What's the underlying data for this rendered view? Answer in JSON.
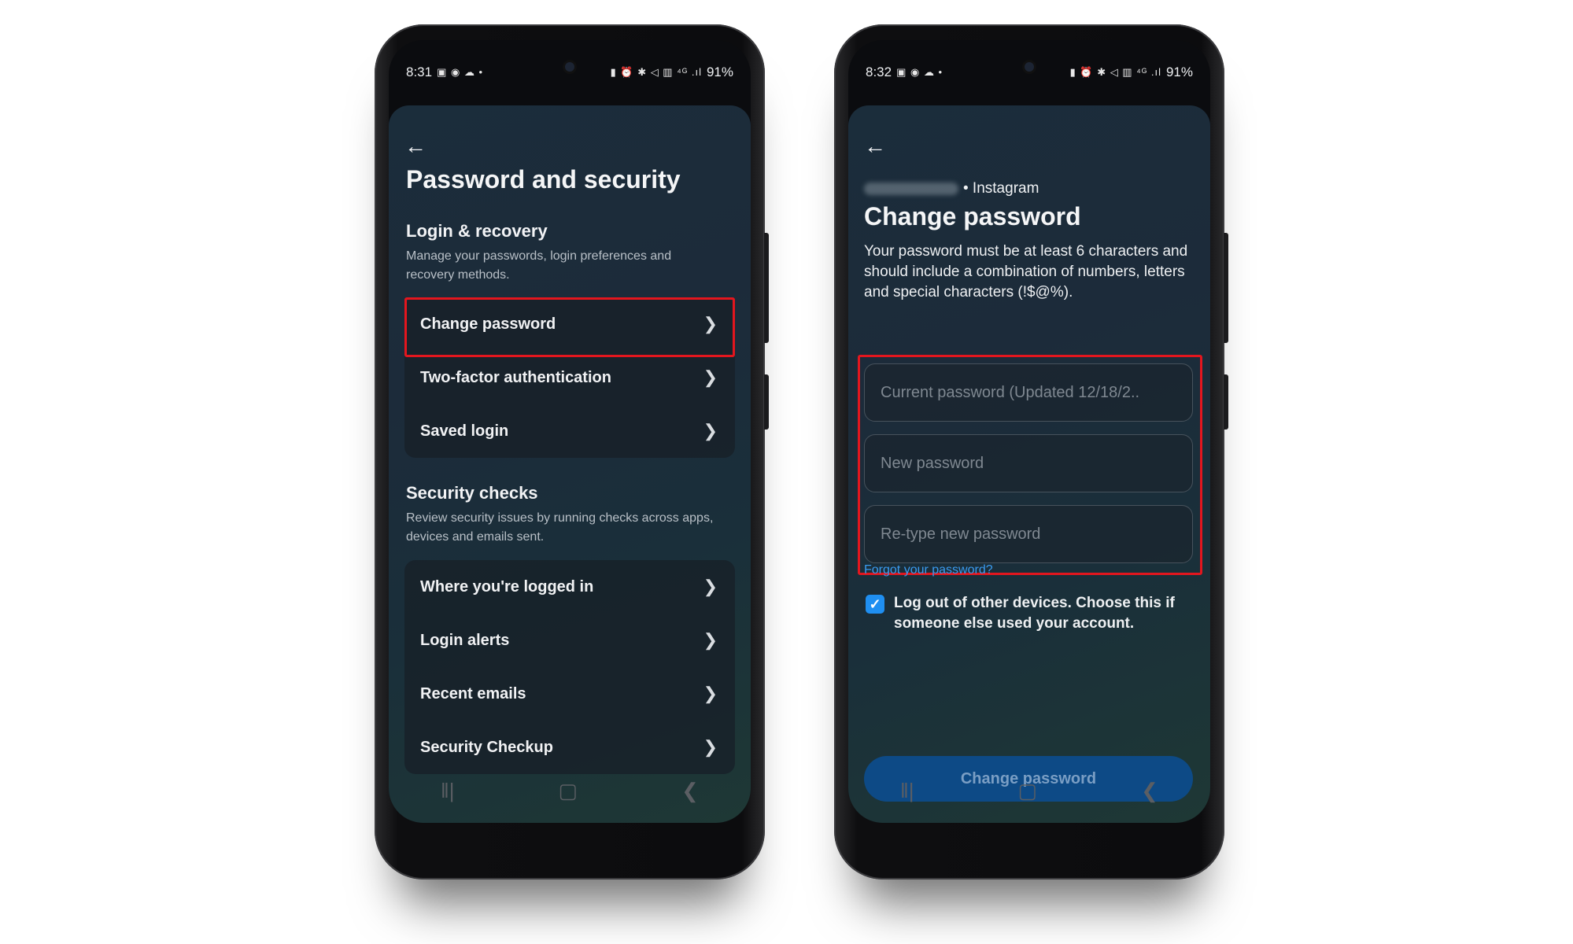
{
  "left_phone": {
    "status": {
      "time": "8:31",
      "icons": "▣ ◉ ☁ •",
      "right_icons": "▮ ⏰ ✱ ◁ ▥ ⁴ᴳ .ıl",
      "battery": "91%"
    },
    "page_title": "Password and security",
    "login_recovery": {
      "title": "Login & recovery",
      "description": "Manage your passwords, login preferences and recovery methods.",
      "items": [
        {
          "label": "Change password"
        },
        {
          "label": "Two-factor authentication"
        },
        {
          "label": "Saved login"
        }
      ]
    },
    "security_checks": {
      "title": "Security checks",
      "description": "Review security issues by running checks across apps, devices and emails sent.",
      "items": [
        {
          "label": "Where you're logged in"
        },
        {
          "label": "Login alerts"
        },
        {
          "label": "Recent emails"
        },
        {
          "label": "Security Checkup"
        }
      ]
    }
  },
  "right_phone": {
    "status": {
      "time": "8:32",
      "icons": "▣ ◉ ☁ •",
      "right_icons": "▮ ⏰ ✱ ◁ ▥ ⁴ᴳ .ıl",
      "battery": "91%"
    },
    "account_suffix": "• Instagram",
    "title": "Change password",
    "description": "Your password must be at least 6 characters and should include a combination of numbers, letters and special characters (!$@%).",
    "fields": {
      "current": "Current password (Updated 12/18/2..",
      "new": "New password",
      "retype": "Re-type new password"
    },
    "forgot_link": "Forgot your password?",
    "logout_checkbox": {
      "checked": true,
      "label": "Log out of other devices. Choose this if someone else used your account."
    },
    "submit_label": "Change password"
  },
  "colors": {
    "highlight": "#e3161e",
    "accent": "#1f8ff1",
    "link": "#3a9bf0",
    "button_bg": "#0d4a86"
  },
  "icons": {
    "back": "back-arrow-icon",
    "chevron": "chevron-right-icon",
    "nav_recent": "recents-icon",
    "nav_home": "home-icon",
    "nav_back": "nav-back-icon"
  }
}
